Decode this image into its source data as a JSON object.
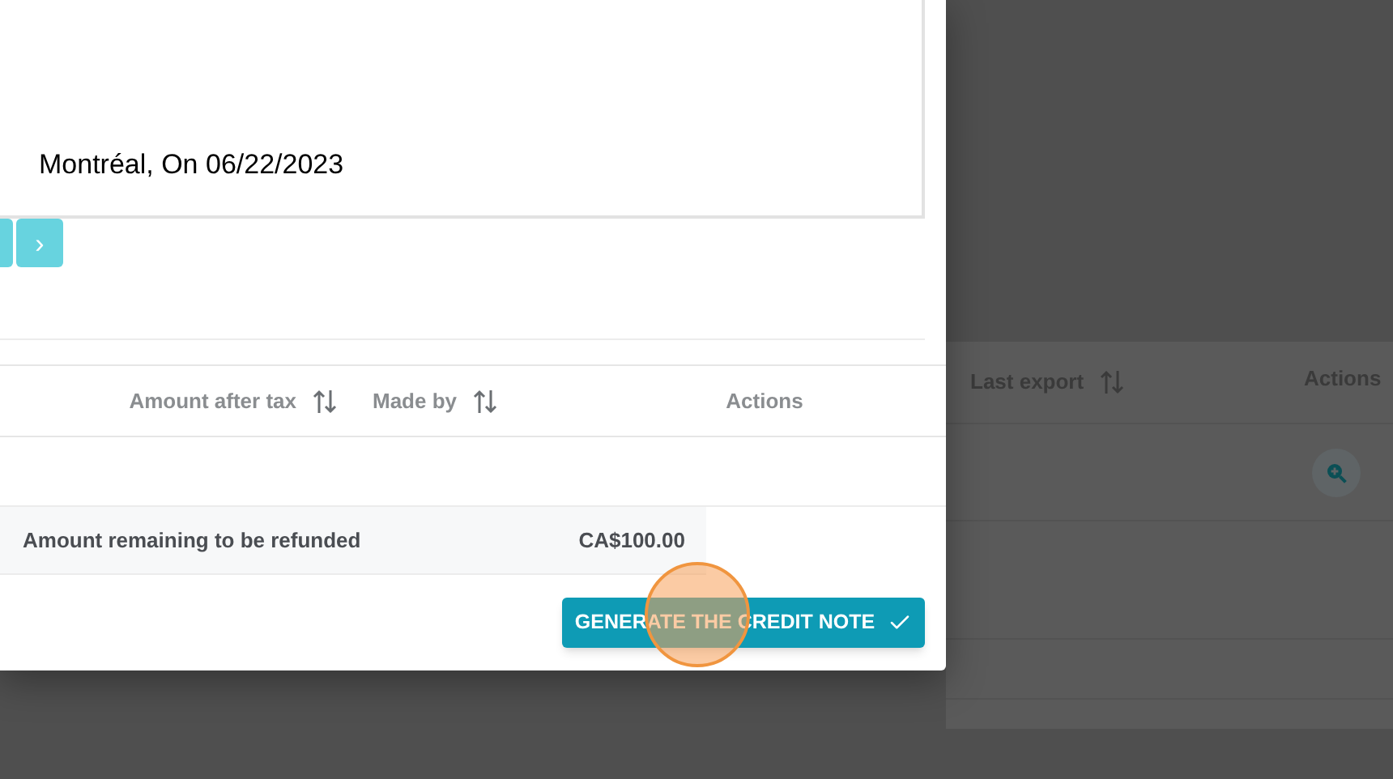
{
  "letter": {
    "place_date": "Montréal, On 06/22/2023"
  },
  "pagination": {
    "next": "›"
  },
  "table": {
    "columns": [
      {
        "label": "Amount after tax",
        "sortable": true
      },
      {
        "label": "Made by",
        "sortable": true
      },
      {
        "label": "Actions",
        "sortable": false
      }
    ],
    "summary": {
      "label": "Amount remaining to be refunded",
      "amount": "CA$100.00"
    }
  },
  "primary_button": {
    "label": "GENERATE THE CREDIT NOTE"
  },
  "background_table": {
    "columns": [
      {
        "label": "Last export",
        "sortable": true
      },
      {
        "label": "Actions",
        "sortable": false
      }
    ]
  }
}
